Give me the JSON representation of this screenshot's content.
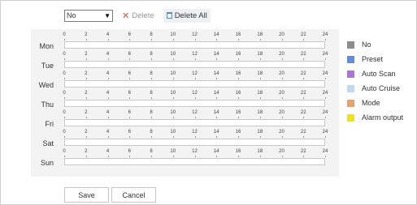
{
  "toolbar": {
    "mode_value": "No",
    "delete_label": "Delete",
    "delete_all_label": "Delete All"
  },
  "schedule": {
    "days": [
      "Mon",
      "Tue",
      "Wed",
      "Thu",
      "Fri",
      "Sat",
      "Sun"
    ],
    "hour_ticks": [
      "0",
      "2",
      "4",
      "6",
      "8",
      "10",
      "12",
      "14",
      "16",
      "18",
      "20",
      "22",
      "24"
    ]
  },
  "legend": [
    {
      "label": "No",
      "color": "#8c8c8c"
    },
    {
      "label": "Preset",
      "color": "#5b8fe6"
    },
    {
      "label": "Auto Scan",
      "color": "#b070e0"
    },
    {
      "label": "Auto Cruise",
      "color": "#b8dcf5"
    },
    {
      "label": "Mode",
      "color": "#f0a060"
    },
    {
      "label": "Alarm output",
      "color": "#f2e600"
    }
  ],
  "actions": {
    "save_label": "Save",
    "cancel_label": "Cancel"
  }
}
